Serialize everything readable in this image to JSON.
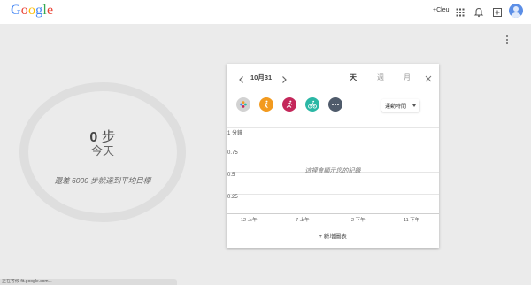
{
  "header": {
    "logo": {
      "G": "G",
      "o1": "o",
      "o2": "o",
      "g": "g",
      "l": "l",
      "e": "e"
    },
    "plus_link": "+Cleu",
    "icons": [
      "apps-grid-icon",
      "notifications-bell-icon",
      "add-share-icon",
      "account-avatar-icon"
    ]
  },
  "summary": {
    "steps_value": "0",
    "steps_unit": "步",
    "period": "今天",
    "goal_text": "還差 6000 步就達到平均目標"
  },
  "card": {
    "date": "10月31",
    "tabs": {
      "day": "天",
      "week": "週",
      "month": "月"
    },
    "metric_select": "運動時間",
    "y_labels": [
      "1 分鐘",
      "0.75",
      "0.5",
      "0.25"
    ],
    "empty_message": "這裡會顯示您的紀錄",
    "x_labels": [
      "12 上午",
      "7 上午",
      "2 下午",
      "11 下午"
    ],
    "add_chart": "+ 新增圖表",
    "activity_colors": {
      "all": "#c9c9c9",
      "walking": "#f29a1f",
      "running": "#c4275a",
      "cycling": "#2bb7a5",
      "more": "#4f5b6b"
    }
  },
  "status_bar": {
    "text": "正在等候 fit.google.com..."
  }
}
